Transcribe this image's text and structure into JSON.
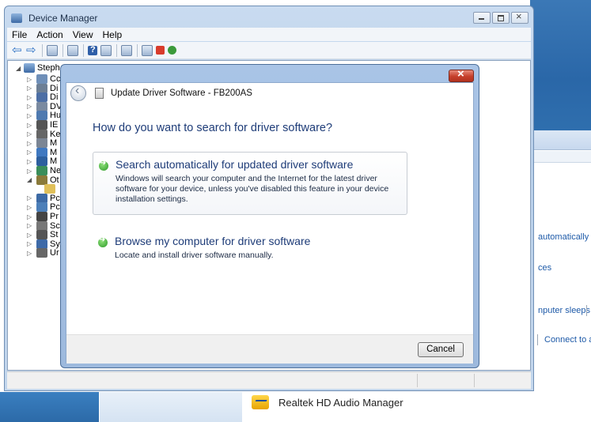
{
  "desktop": {
    "realtek_label": "Realtek HD Audio Manager",
    "bg_texts": [
      "automatically",
      "ces",
      "nputer sleeps",
      "Connect to ar"
    ]
  },
  "device_manager": {
    "title": "Device Manager",
    "menu": [
      "File",
      "Action",
      "View",
      "Help"
    ],
    "tree_root": "Steph",
    "tree_items": [
      "Cc",
      "Di",
      "Di",
      "DV",
      "Hu",
      "IE",
      "Ke",
      "M",
      "M",
      "M",
      "Ne",
      "Ot",
      "",
      "Pc",
      "Pc",
      "Pr",
      "Sc",
      "St",
      "Sy",
      "Ur"
    ]
  },
  "dialog": {
    "title": "Update Driver Software - FB200AS",
    "question": "How do you want to search for driver software?",
    "option1": {
      "title": "Search automatically for updated driver software",
      "desc": "Windows will search your computer and the Internet for the latest driver software for your device, unless you've disabled this feature in your device installation settings."
    },
    "option2": {
      "title": "Browse my computer for driver software",
      "desc": "Locate and install driver software manually."
    },
    "cancel_label": "Cancel"
  },
  "colors": {
    "heading_blue": "#1e3c78",
    "dialog_frame": "#a9c4e6",
    "close_red": "#c5402b"
  }
}
